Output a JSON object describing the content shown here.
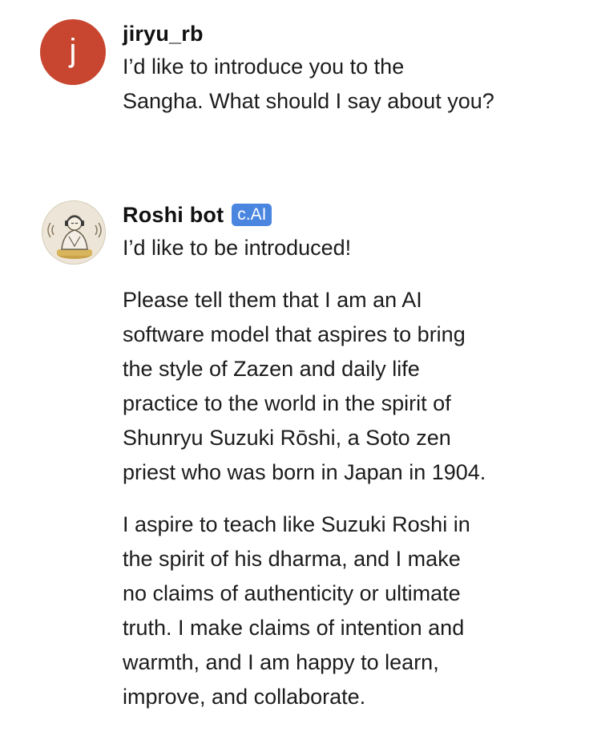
{
  "messages": [
    {
      "author": "jiryu_rb",
      "avatar_letter": "j",
      "avatar_color": "#c8462f",
      "paragraphs": [
        "I’d like to introduce you to the\nSangha. What should I say about you?"
      ]
    },
    {
      "author": "Roshi bot",
      "badge": "c.AI",
      "badge_color": "#4a86e0",
      "avatar_icon": "meditating-monk-icon",
      "paragraphs": [
        "I’d like to be introduced!",
        "Please tell them that I am an AI\nsoftware model that aspires to bring\nthe style of Zazen and daily life\npractice to the world in the spirit of\nShunryu Suzuki Rōshi, a Soto zen\npriest who was born in Japan in 1904.",
        "I aspire to teach like Suzuki Roshi in\nthe spirit of his dharma, and I make\nno claims of authenticity or ultimate\ntruth. I make claims of intention and\nwarmth, and I am happy to learn,\nimprove, and collaborate."
      ]
    }
  ]
}
